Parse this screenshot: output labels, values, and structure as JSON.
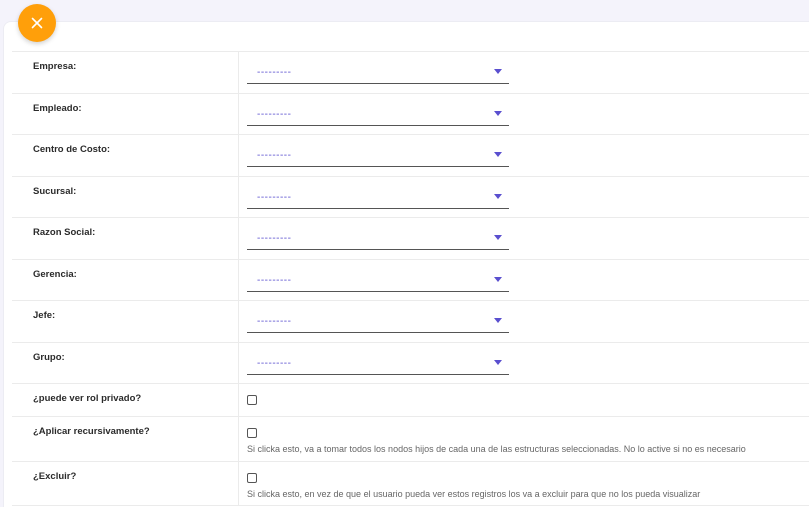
{
  "colors": {
    "accent_orange": "#ff9f0a",
    "select_text": "#5a4fcf",
    "page_bg": "#f4f3fb"
  },
  "close_button": {
    "icon": "close-icon"
  },
  "fields": [
    {
      "label": "Empresa:",
      "value": "---------"
    },
    {
      "label": "Empleado:",
      "value": "---------"
    },
    {
      "label": "Centro de Costo:",
      "value": "---------"
    },
    {
      "label": "Sucursal:",
      "value": "---------"
    },
    {
      "label": "Razon Social:",
      "value": "---------"
    },
    {
      "label": "Gerencia:",
      "value": "---------"
    },
    {
      "label": "Jefe:",
      "value": "---------"
    },
    {
      "label": "Grupo:",
      "value": "---------"
    }
  ],
  "checks": [
    {
      "label": "¿puede ver rol privado?",
      "checked": false,
      "help": ""
    },
    {
      "label": "¿Aplicar recursivamente?",
      "checked": false,
      "help": "Si clicka esto, va a tomar todos los nodos hijos de cada una de las estructuras seleccionadas. No lo active si no es necesario"
    },
    {
      "label": "¿Excluir?",
      "checked": false,
      "help": "Si clicka esto, en vez de que el usuario pueda ver estos registros los va a excluir para que no los pueda visualizar"
    }
  ]
}
